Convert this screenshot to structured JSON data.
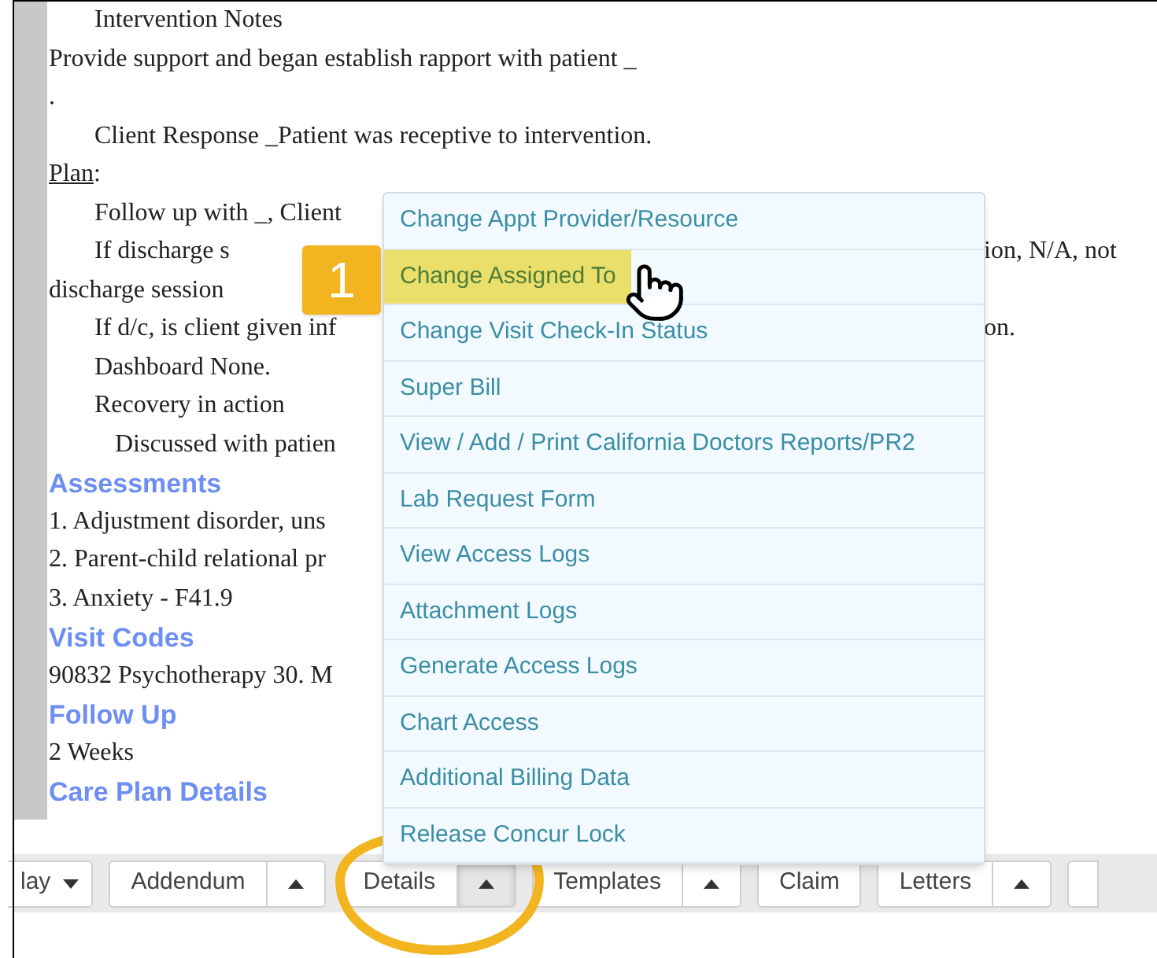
{
  "note": {
    "lines": [
      {
        "kind": "indented",
        "left": "Intervention Notes"
      },
      {
        "kind": "text",
        "left": "Provide support and began establish rapport with patient _"
      },
      {
        "kind": "text",
        "left": "."
      },
      {
        "kind": "indented",
        "left": "Client Response _Patient was receptive to intervention."
      },
      {
        "kind": "label",
        "left": "Plan",
        "suffix": ":"
      },
      {
        "kind": "indented",
        "left": "Follow up with _, Client"
      },
      {
        "kind": "indented",
        "left": "If discharge s",
        "right": "ion, N/A, not"
      },
      {
        "kind": "text",
        "left": "discharge session"
      },
      {
        "kind": "indented",
        "left": "If d/c, is client given inf",
        "right": "on."
      },
      {
        "kind": "indented",
        "left": "Dashboard None."
      },
      {
        "kind": "indented",
        "left": "Recovery in action"
      },
      {
        "kind": "subindented",
        "left": "Discussed with patien"
      },
      {
        "kind": "heading",
        "left": "Assessments"
      },
      {
        "kind": "text",
        "left": "1. Adjustment disorder, uns"
      },
      {
        "kind": "text",
        "left": "2. Parent-child relational pr"
      },
      {
        "kind": "text",
        "left": "3. Anxiety - F41.9"
      },
      {
        "kind": "heading",
        "left": "Visit Codes"
      },
      {
        "kind": "text",
        "left": "90832 Psychotherapy 30. M"
      },
      {
        "kind": "heading",
        "left": "Follow Up"
      },
      {
        "kind": "text",
        "left": "2 Weeks"
      },
      {
        "kind": "heading",
        "left": "Care Plan Details"
      }
    ]
  },
  "step_badge": "1",
  "menu": {
    "items": [
      {
        "label": "Change Appt Provider/Resource",
        "selected": false
      },
      {
        "label": "Change Assigned To",
        "selected": true
      },
      {
        "label": "Change Visit Check-In Status",
        "selected": false
      },
      {
        "label": "Super Bill",
        "selected": false
      },
      {
        "label": "View / Add / Print California Doctors Reports/PR2",
        "selected": false
      },
      {
        "label": "Lab Request Form",
        "selected": false
      },
      {
        "label": "View Access Logs",
        "selected": false
      },
      {
        "label": "Attachment Logs",
        "selected": false
      },
      {
        "label": "Generate Access Logs",
        "selected": false
      },
      {
        "label": "Chart Access",
        "selected": false
      },
      {
        "label": "Additional Billing Data",
        "selected": false
      },
      {
        "label": "Release Concur Lock",
        "selected": false
      }
    ]
  },
  "toolbar": [
    {
      "kind": "dropdown",
      "label": "lay",
      "active": false
    },
    {
      "kind": "split",
      "label": "Addendum",
      "active": false
    },
    {
      "kind": "split",
      "label": "Details",
      "active": true
    },
    {
      "kind": "split",
      "label": "Templates",
      "active": false
    },
    {
      "kind": "plain",
      "label": "Claim",
      "active": false
    },
    {
      "kind": "split",
      "label": "Letters",
      "active": false
    },
    {
      "kind": "edge",
      "active": false
    }
  ]
}
